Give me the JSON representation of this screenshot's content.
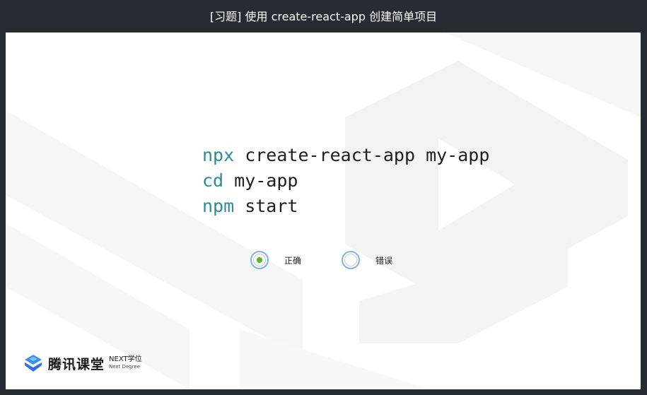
{
  "header": {
    "title": "[习题] 使用 create-react-app 创建简单项目"
  },
  "code": {
    "lines": [
      {
        "cmd": "npx",
        "rest": " create-react-app my-app"
      },
      {
        "cmd": "cd",
        "rest": " my-app"
      },
      {
        "cmd": "npm",
        "rest": " start"
      }
    ]
  },
  "quiz": {
    "options": [
      {
        "label": "正确",
        "selected": true
      },
      {
        "label": "错误",
        "selected": false
      }
    ]
  },
  "brand": {
    "name": "腾讯课堂",
    "tag_top": "NEXT学位",
    "tag_bottom": "Next Degree"
  },
  "colors": {
    "command": "#2f8b96",
    "radio_border": "#7fb1ec",
    "radio_selected": "#5ab231",
    "logo_blue": "#3b8ff0"
  }
}
